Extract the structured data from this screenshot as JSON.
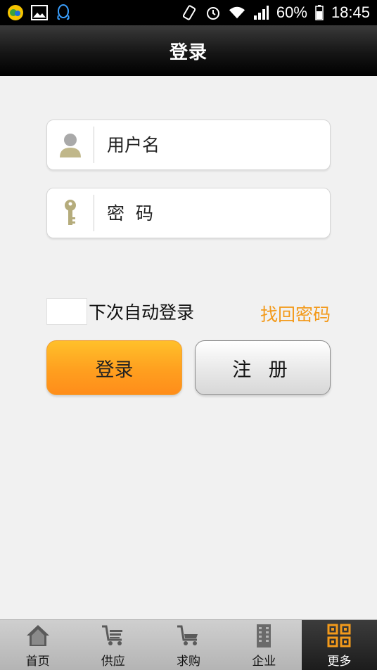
{
  "status_bar": {
    "battery": "60%",
    "time": "18:45",
    "icons": [
      "app-notification-icon",
      "image-icon",
      "qq-icon",
      "vibrate-icon",
      "alarm-icon",
      "wifi-icon",
      "signal-icon",
      "battery-icon"
    ]
  },
  "header": {
    "title": "登录"
  },
  "login_form": {
    "username": {
      "placeholder": "用户名",
      "value": "",
      "icon": "user-icon"
    },
    "password": {
      "placeholder": "密  码",
      "value": "",
      "icon": "key-icon"
    },
    "remember_label": "下次自动登录",
    "remember_checked": false,
    "forgot_label": "找回密码",
    "login_label": "登录",
    "register_label": "注 册"
  },
  "bottom_nav": {
    "items": [
      {
        "label": "首页",
        "icon": "home-icon"
      },
      {
        "label": "供应",
        "icon": "supply-cart-icon"
      },
      {
        "label": "求购",
        "icon": "purchase-cart-icon"
      },
      {
        "label": "企业",
        "icon": "building-icon"
      },
      {
        "label": "更多",
        "icon": "grid-icon"
      }
    ],
    "active_index": 4
  },
  "colors": {
    "accent_orange": "#f39a1b",
    "titlebar": "#000000",
    "background": "#f1f1f1"
  }
}
